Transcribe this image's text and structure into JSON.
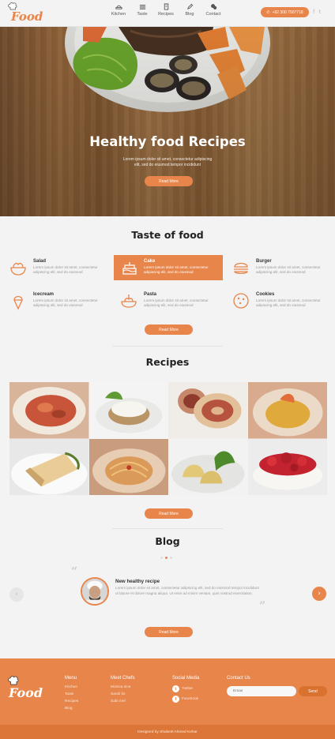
{
  "brand": {
    "logo_text": "Food"
  },
  "nav": {
    "items": [
      {
        "label": "Kitchen",
        "icon": "kitchen-icon"
      },
      {
        "label": "Taste",
        "icon": "taste-icon"
      },
      {
        "label": "Recipes",
        "icon": "recipes-icon"
      },
      {
        "label": "Blog",
        "icon": "pencil-icon"
      },
      {
        "label": "Contact",
        "icon": "chat-icon"
      }
    ],
    "phone": "+92 300 7507718",
    "social": [
      "f",
      "t"
    ]
  },
  "hero": {
    "title": "Healthy food Recipes",
    "subtitle_line1": "Lorem ipsum dolor sit amet, consectetur adipiscing",
    "subtitle_line2": "elit, sed do eiusmod tempor incididunt",
    "button": "Read More"
  },
  "taste": {
    "title": "Taste of food",
    "items": [
      {
        "name": "Salad",
        "desc": "Lorem ipsum dolor sit amet, consectetur adipiscing elit, sed do eiusmod",
        "icon": "salad-icon"
      },
      {
        "name": "Cake",
        "desc": "Lorem ipsum dolor sit amet, consectetur adipiscing elit, sed do eiusmod",
        "icon": "cake-icon"
      },
      {
        "name": "Burger",
        "desc": "Lorem ipsum dolor sit amet, consectetur adipiscing elit, sed do eiusmod",
        "icon": "burger-icon"
      },
      {
        "name": "Icecream",
        "desc": "Lorem ipsum dolor sit amet, consectetur adipiscing elit, sed do eiusmod",
        "icon": "icecream-icon"
      },
      {
        "name": "Pasta",
        "desc": "Lorem ipsum dolor sit amet, consectetur adipiscing elit, sed do eiusmod",
        "icon": "pasta-icon"
      },
      {
        "name": "Cookies",
        "desc": "Lorem ipsum dolor sit amet, consectetur adipiscing elit, sed do eiusmod",
        "icon": "cookies-icon"
      }
    ],
    "button": "Read More"
  },
  "recipes": {
    "title": "Recipes",
    "button": "Read More"
  },
  "blog": {
    "title": "Blog",
    "post_title": "New healthy recipe",
    "post_text": "Lorem ipsum dolor sit amet, consectetur adipiscing elit, sed do eiusmod tempor incididunt ut labore et dolore magna aliqua. Ut enim ad minim veniam, quis nostrud exercitation.",
    "button": "Read More",
    "active_slide": 2,
    "slide_count": 3
  },
  "footer": {
    "logo_text": "Food",
    "menu": {
      "title": "Menu",
      "links": [
        "Kitchen",
        "Taste",
        "Recipes",
        "Blog"
      ]
    },
    "chefs": {
      "title": "Meet Chefs",
      "names": [
        "Monica sins",
        "Sandi lin",
        "Sabi mel"
      ]
    },
    "social": {
      "title": "Social Media",
      "links": [
        "Twitter",
        "Facebook"
      ]
    },
    "contact": {
      "title": "Contact Us",
      "placeholder": "Email",
      "send": "Send"
    },
    "copyright": "Designed by Shakeel Ahmed Kehar"
  },
  "colors": {
    "accent": "#e8854a",
    "background": "#f3f3f3"
  }
}
